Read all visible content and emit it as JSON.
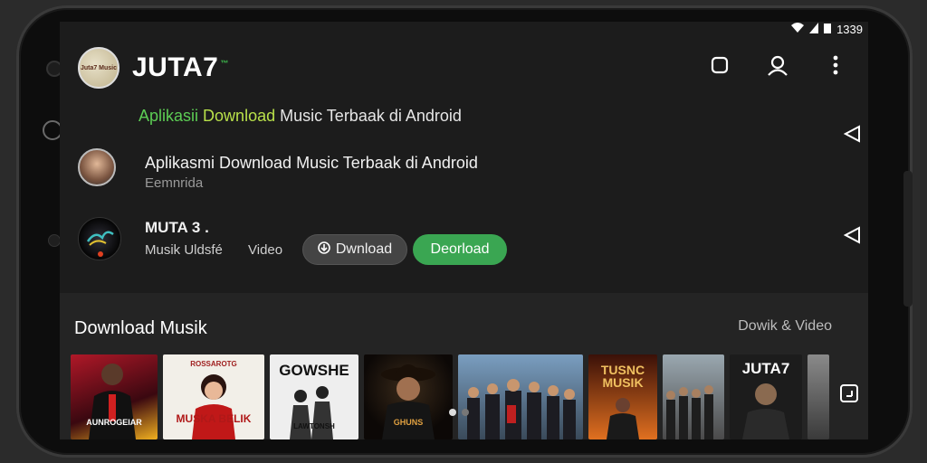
{
  "status": {
    "time": "1339"
  },
  "header": {
    "title": "JUTA7",
    "title_mark": "™",
    "logo_text": "Juta7 Music"
  },
  "subtitle": {
    "part1": "Aplikasii",
    "part2": "Download",
    "part3": "Music Terbaak di Android"
  },
  "rows": [
    {
      "title": "Aplikasmi Download Music Terbaak di Android",
      "subtitle": "Eemnrida"
    },
    {
      "title": "MUTA 3 .",
      "subtitle": "Musik Uldsfé",
      "subtitle2": "Video",
      "button_dark": "Dwnload",
      "button_green": "Deorload"
    }
  ],
  "section": {
    "title": "Download Musik",
    "link": "Dowik & Video",
    "thumbnails": [
      {
        "caption": "AUNROGEIAR",
        "bg": "#6b1020"
      },
      {
        "caption": "MUSKA BELIK",
        "top": "ROSSAROTG",
        "bg": "#f2efe8"
      },
      {
        "caption": "GOWSHE",
        "bottom": "LAWTONSH",
        "bg": "#eeeeee"
      },
      {
        "caption": "GHUNS",
        "bg": "#1a1410"
      },
      {
        "caption": "",
        "bg": "#5f7e9c"
      },
      {
        "caption": "TUSNC MUSIK",
        "bg": "#8a2a10"
      },
      {
        "caption": "",
        "bg": "#6a6a6a"
      },
      {
        "caption": "JUTA7",
        "bg": "#1c1c1c"
      },
      {
        "caption": "",
        "bg": "#4a4a4a"
      }
    ]
  }
}
